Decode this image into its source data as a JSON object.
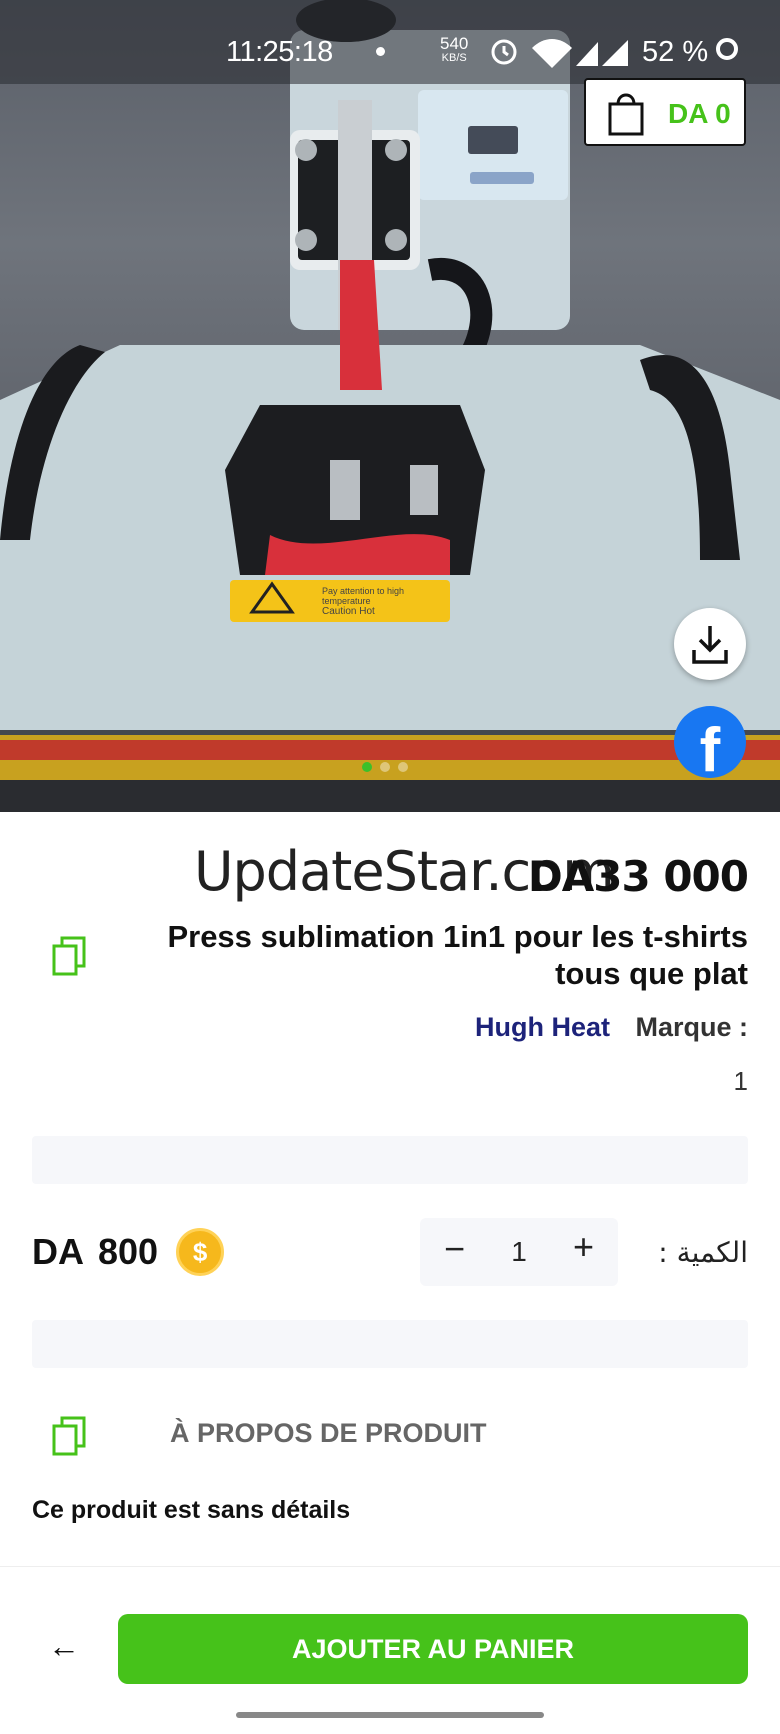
{
  "status_bar": {
    "time": "11:25:18",
    "net_speed_value": "540",
    "net_speed_unit": "KB/S",
    "battery": "52 %",
    "icons": [
      "alarm-icon",
      "wifi-icon",
      "signal-icon",
      "signal-icon"
    ]
  },
  "cart": {
    "total": "DA 0",
    "icon": "shopping-bag-icon"
  },
  "hero": {
    "image_alt": "heat press machine photo",
    "warning_label": [
      "Pay attention to high",
      "temperature",
      "Caution Hot"
    ],
    "carousel": {
      "count": 3,
      "active_index": 0
    }
  },
  "actions": {
    "download_icon": "download-icon",
    "facebook_icon": "facebook-icon",
    "facebook_glyph": "f"
  },
  "product": {
    "watermark": "UpdateStar.com",
    "price": "DA33 000",
    "title": "Press sublimation 1in1 pour les t-shirts tous que plat",
    "brand_name": "Hugh Heat",
    "brand_label": "Marque :",
    "stock": "1"
  },
  "points": {
    "currency": "DA",
    "amount": "800",
    "coin_symbol": "$"
  },
  "quantity": {
    "label": "الكمية :",
    "value": "1",
    "minus": "−",
    "plus": "+"
  },
  "about": {
    "title": "À PROPOS DE PRODUIT",
    "text": "Ce produit est sans détails"
  },
  "bottom": {
    "back_icon": "←",
    "add_to_cart": "AJOUTER AU PANIER"
  },
  "colors": {
    "accent": "#46c21a",
    "brand_text": "#1d237a",
    "facebook": "#1877f2",
    "coin": "#f6b81c"
  }
}
